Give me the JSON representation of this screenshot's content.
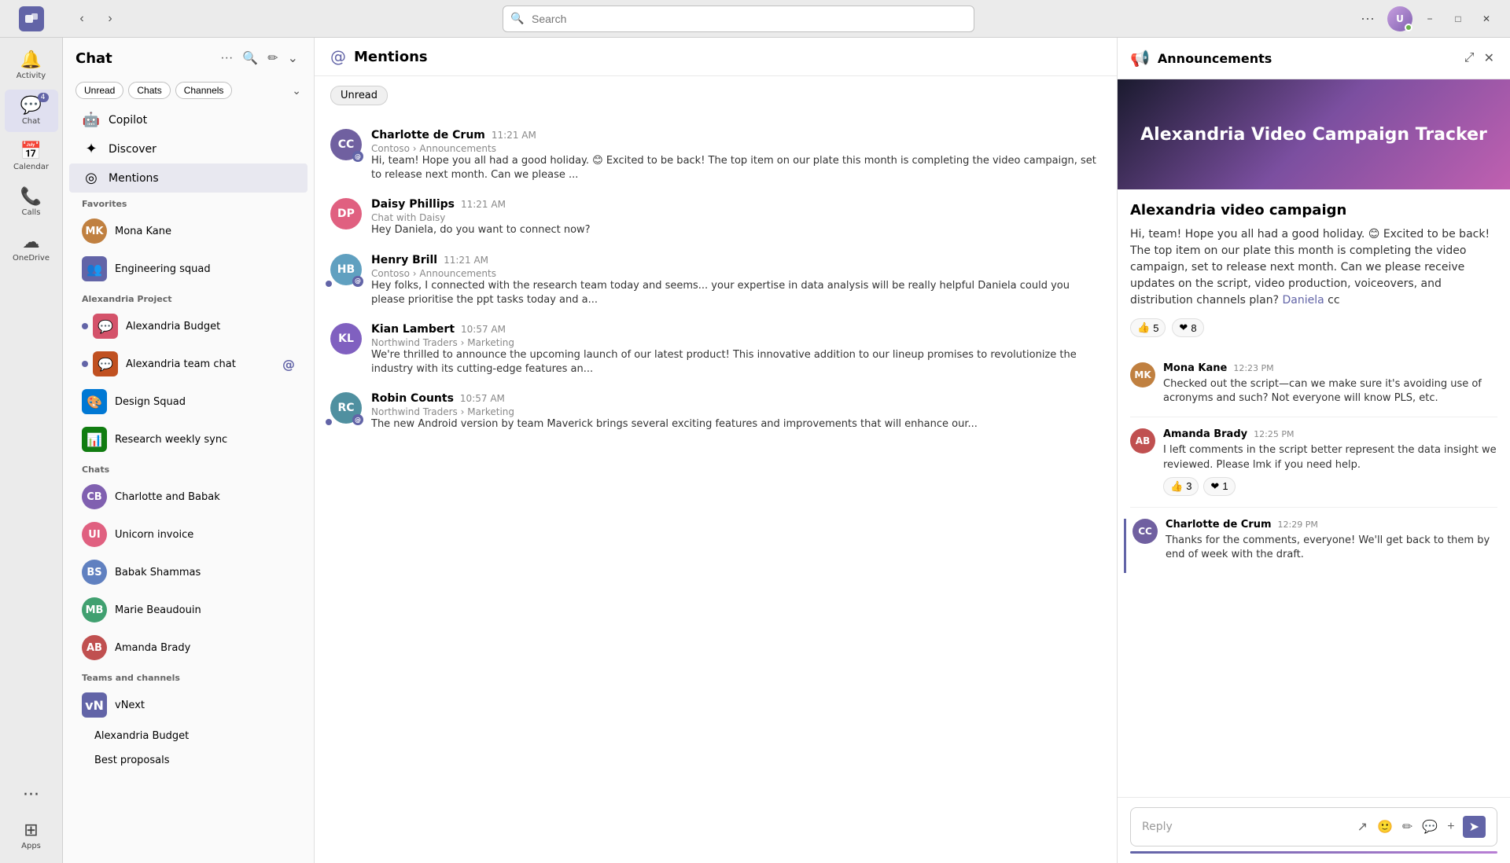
{
  "titleBar": {
    "teamsLogo": "T",
    "searchPlaceholder": "Search",
    "userInitials": "U",
    "moreLabel": "···",
    "minimizeLabel": "−",
    "maximizeLabel": "□",
    "closeLabel": "✕"
  },
  "rail": {
    "items": [
      {
        "id": "activity",
        "icon": "🔔",
        "label": "Activity"
      },
      {
        "id": "chat",
        "icon": "💬",
        "label": "Chat",
        "badge": "4",
        "active": true
      },
      {
        "id": "calendar",
        "icon": "📅",
        "label": "Calendar"
      },
      {
        "id": "calls",
        "icon": "📞",
        "label": "Calls"
      },
      {
        "id": "onedrive",
        "icon": "☁",
        "label": "OneDrive"
      },
      {
        "id": "more",
        "icon": "···",
        "label": ""
      },
      {
        "id": "apps",
        "icon": "⊞",
        "label": "Apps"
      }
    ]
  },
  "sidebar": {
    "title": "Chat",
    "filters": [
      {
        "id": "unread",
        "label": "Unread",
        "active": false
      },
      {
        "id": "chats",
        "label": "Chats",
        "active": false
      },
      {
        "id": "channels",
        "label": "Channels",
        "active": false
      }
    ],
    "pinnedItems": [
      {
        "id": "copilot",
        "icon": "🤖",
        "label": "Copilot",
        "iconBg": "#6264a7"
      },
      {
        "id": "discover",
        "icon": "✦",
        "label": "Discover",
        "iconBg": "#888"
      }
    ],
    "activeNavItem": "Mentions",
    "navItems": [
      {
        "id": "mentions",
        "icon": "◎",
        "label": "Mentions"
      }
    ],
    "sections": [
      {
        "label": "Favorites",
        "items": [
          {
            "id": "mona-kane",
            "name": "Mona Kane",
            "avatarBg": "#c08040",
            "type": "person"
          },
          {
            "id": "eng-squad",
            "name": "Engineering squad",
            "avatarBg": "#6264a7",
            "type": "group"
          }
        ]
      },
      {
        "label": "Alexandria Project",
        "items": [
          {
            "id": "alex-budget",
            "name": "Alexandria Budget",
            "avatarBg": "#d4526a",
            "type": "group",
            "bullet": true,
            "active": false
          },
          {
            "id": "alex-team-chat",
            "name": "Alexandria team chat",
            "avatarBg": "#c05020",
            "type": "group",
            "bullet": true,
            "active": false,
            "mention": true
          },
          {
            "id": "design-squad",
            "name": "Design Squad",
            "avatarBg": "#0078d4",
            "type": "group"
          },
          {
            "id": "research-weekly",
            "name": "Research weekly sync",
            "avatarBg": "#107c10",
            "type": "group"
          }
        ]
      },
      {
        "label": "Chats",
        "items": [
          {
            "id": "charlotte-babak",
            "name": "Charlotte and Babak",
            "avatarBg": "#8060b0",
            "type": "person"
          },
          {
            "id": "unicorn-invoice",
            "name": "Unicorn invoice",
            "avatarBg": "#e06080",
            "type": "person"
          },
          {
            "id": "babak-shammas",
            "name": "Babak Shammas",
            "avatarBg": "#6080c0",
            "type": "person"
          },
          {
            "id": "marie-beaudouin",
            "name": "Marie Beaudouin",
            "initials": "MB",
            "avatarBg": "#40a070",
            "type": "person"
          },
          {
            "id": "amanda-brady",
            "name": "Amanda Brady",
            "avatarBg": "#c05050",
            "type": "person"
          }
        ]
      },
      {
        "label": "Teams and channels",
        "items": [
          {
            "id": "vnext",
            "name": "vNext",
            "avatarBg": "#6264a7",
            "type": "group"
          },
          {
            "id": "alex-budget-ch",
            "name": "Alexandria Budget",
            "type": "channel",
            "indent": true
          },
          {
            "id": "best-proposals",
            "name": "Best proposals",
            "type": "channel",
            "indent": true
          }
        ]
      }
    ]
  },
  "mainPane": {
    "title": "Mentions",
    "icon": "@",
    "unreadTag": "Unread",
    "messages": [
      {
        "id": "msg1",
        "sender": "Charlotte de Crum",
        "avatarBg": "#7060a0",
        "initials": "CC",
        "time": "11:21 AM",
        "source": "Contoso › Announcements",
        "text": "Hi, team! Hope you all had a good holiday. 😊 Excited to be back! The top item on our plate this month is completing the video campaign, set to release next month. Can we please ...",
        "hasAt": true
      },
      {
        "id": "msg2",
        "sender": "Daisy Phillips",
        "avatarBg": "#e06080",
        "initials": "DP",
        "time": "11:21 AM",
        "source": "Chat with Daisy",
        "text": "Hey Daniela, do you want to connect now?"
      },
      {
        "id": "msg3",
        "sender": "Henry Brill",
        "avatarBg": "#60a0c0",
        "initials": "HB",
        "time": "11:21 AM",
        "source": "Contoso › Announcements",
        "text": "Hey folks, I connected with the research team today and seems... your expertise in data analysis will be really helpful Daniela could you please prioritise the ppt tasks today and a...",
        "hasDot": true,
        "hasAt": true
      },
      {
        "id": "msg4",
        "sender": "Kian Lambert",
        "avatarBg": "#8060c0",
        "initials": "KL",
        "time": "10:57 AM",
        "source": "Northwind Traders › Marketing",
        "text": "We're thrilled to announce the upcoming launch of our latest product! This innovative addition to our lineup promises to revolutionize the industry with its cutting-edge features an..."
      },
      {
        "id": "msg5",
        "sender": "Robin Counts",
        "avatarBg": "#5090a0",
        "initials": "RC",
        "time": "10:57 AM",
        "source": "Northwind Traders › Marketing",
        "text": "The new Android version by team Maverick brings several exciting features and improvements that will enhance our...",
        "hasDot": true,
        "hasAt": true
      }
    ]
  },
  "rightPanel": {
    "title": "Announcements",
    "iconEmoji": "📢",
    "banner": {
      "text": "Alexandria Video Campaign Tracker"
    },
    "announcementTitle": "Alexandria video campaign",
    "announcementText": "Hi, team! Hope you all had a good holiday. 😊 Excited to be back! The top item on our plate this month is completing the video campaign, set to release next month. Can we please receive updates on the script, video production, voiceovers, and distribution channels plan?",
    "mentionName": "Daniela",
    "mentionSuffix": " cc",
    "topReactions": [
      {
        "emoji": "👍",
        "count": "5"
      },
      {
        "emoji": "❤",
        "count": "8"
      }
    ],
    "replies": [
      {
        "id": "r1",
        "name": "Mona Kane",
        "time": "12:23 PM",
        "avatarBg": "#c08040",
        "initials": "MK",
        "text": "Checked out the script—can we make sure it's avoiding use of acronyms and such? Not everyone will know PLS, etc.",
        "reactions": []
      },
      {
        "id": "r2",
        "name": "Amanda Brady",
        "time": "12:25 PM",
        "avatarBg": "#c05050",
        "initials": "AB",
        "text": "I left comments in the script better represent the data insight we reviewed. Please lmk if you need help.",
        "reactions": [
          {
            "emoji": "👍",
            "count": "3"
          },
          {
            "emoji": "❤",
            "count": "1"
          }
        ]
      },
      {
        "id": "r3",
        "name": "Charlotte de Crum",
        "time": "12:29 PM",
        "avatarBg": "#7060a0",
        "initials": "CC",
        "text": "Thanks for the comments, everyone! We'll get back to them by end of week with the draft.",
        "reactions": [],
        "active": true
      }
    ],
    "replyPlaceholder": "Reply"
  }
}
